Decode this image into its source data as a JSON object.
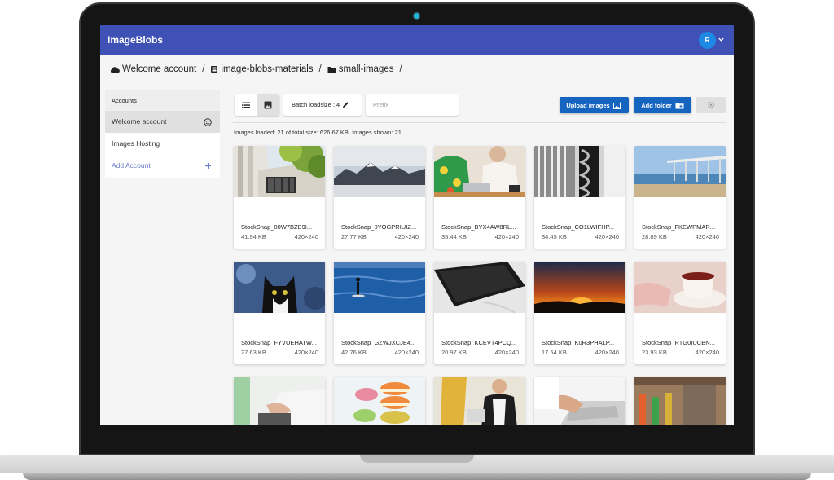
{
  "app": {
    "title": "ImageBlobs",
    "user_initial": "R"
  },
  "breadcrumb": [
    {
      "label": "Welcome account",
      "icon": "cloud-icon"
    },
    {
      "label": "image-blobs-materials",
      "icon": "bucket-icon"
    },
    {
      "label": "small-images",
      "icon": "folder-icon"
    }
  ],
  "breadcrumb_separator": "/",
  "sidebar": {
    "header": "Accounts",
    "items": [
      {
        "label": "Welcome account",
        "active": true,
        "icon": "smile-icon"
      },
      {
        "label": "Images Hosting",
        "active": false
      },
      {
        "label": "Add Account",
        "active": false,
        "icon": "plus-icon"
      }
    ]
  },
  "toolbar": {
    "batch_label": "Batch loadsize : 4",
    "prefix_placeholder": "Prefix",
    "upload_label": "Upload images",
    "add_folder_label": "Add folder"
  },
  "stats": "Images loaded: 21 of total size: 626.67 KB. Images shown: 21",
  "colors": {
    "appbar": "#3f51b5",
    "button": "#1565c0",
    "avatar": "#1e88e5",
    "link": "#6b7fc9"
  },
  "images": [
    {
      "name": "StockSnap_00W7BZB9I...",
      "size": "41.94 KB",
      "dims": "420×240"
    },
    {
      "name": "StockSnap_0YOGPRIUIZ...",
      "size": "27.77 KB",
      "dims": "420×240"
    },
    {
      "name": "StockSnap_BYX4AW8RL...",
      "size": "35.44 KB",
      "dims": "420×240"
    },
    {
      "name": "StockSnap_CO1LWIFHP...",
      "size": "34.45 KB",
      "dims": "420×240"
    },
    {
      "name": "StockSnap_FKEWPMAR...",
      "size": "28.89 KB",
      "dims": "420×240"
    },
    {
      "name": "StockSnap_FYVUEHATW...",
      "size": "27.63 KB",
      "dims": "420×240"
    },
    {
      "name": "StockSnap_GZWJXCJE4...",
      "size": "42.76 KB",
      "dims": "420×240"
    },
    {
      "name": "StockSnap_KCEVT4PCQ...",
      "size": "20.97 KB",
      "dims": "420×240"
    },
    {
      "name": "StockSnap_K0R3PHALP...",
      "size": "17.54 KB",
      "dims": "420×240"
    },
    {
      "name": "StockSnap_RTG0IUCBN...",
      "size": "23.93 KB",
      "dims": "420×240"
    },
    {
      "name": "",
      "size": "",
      "dims": ""
    },
    {
      "name": "",
      "size": "",
      "dims": ""
    },
    {
      "name": "",
      "size": "",
      "dims": ""
    },
    {
      "name": "",
      "size": "",
      "dims": ""
    },
    {
      "name": "",
      "size": "",
      "dims": ""
    }
  ]
}
